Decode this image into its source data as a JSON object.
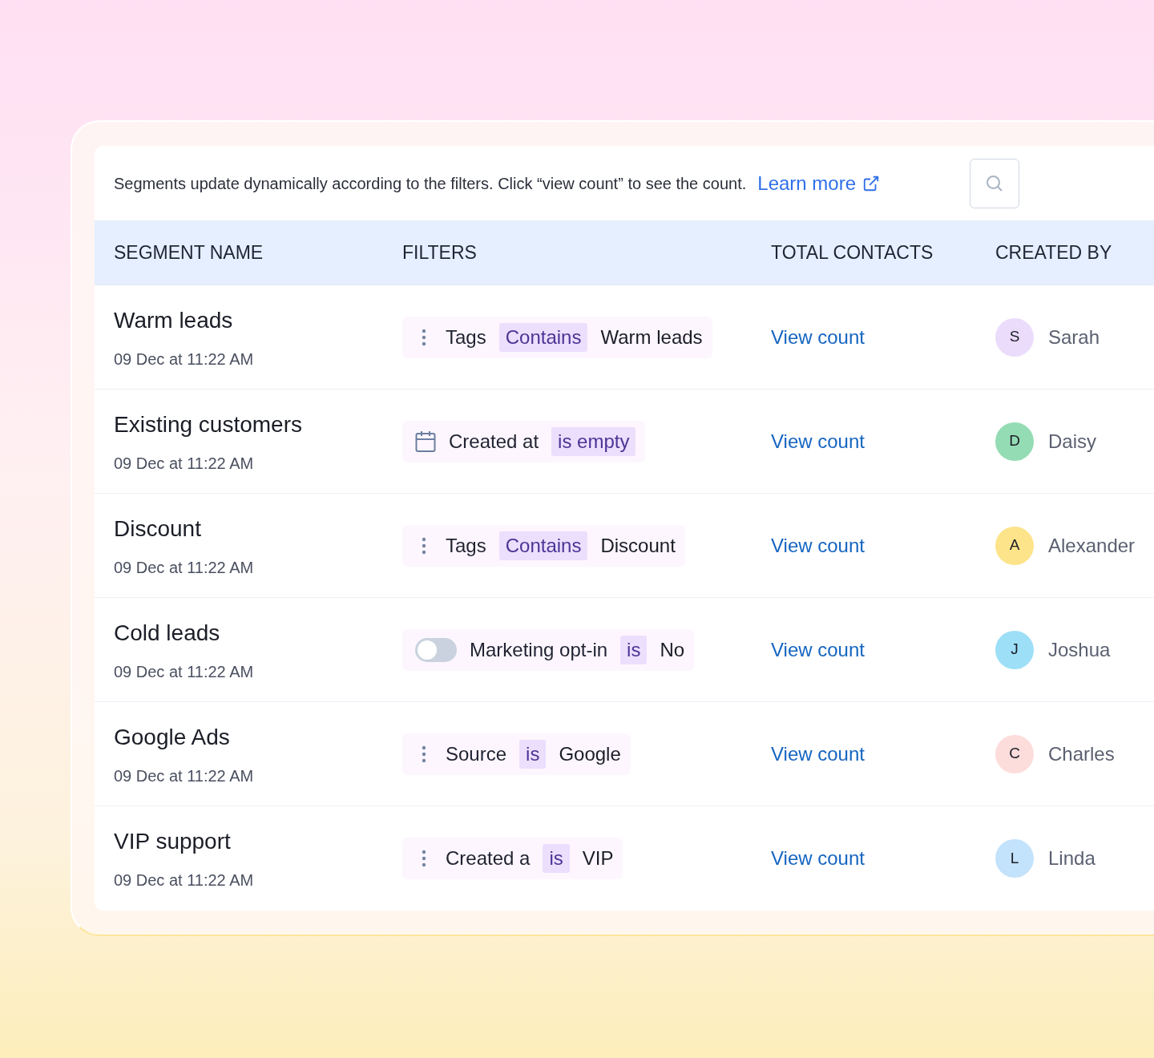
{
  "info_bar": {
    "text": "Segments update dynamically according to the filters. Click “view count” to see the count.",
    "link": "Learn more"
  },
  "table": {
    "columns": [
      "SEGMENT NAME",
      "FILTERS",
      "TOTAL CONTACTS",
      "CREATED BY"
    ],
    "rows": [
      {
        "name": "Warm leads",
        "date": "09 Dec at 11:22 AM",
        "filter": {
          "kind": "menu",
          "field": "Tags",
          "operator": "Contains",
          "value": "Warm leads"
        },
        "count": "View count",
        "creator": {
          "initial": "S",
          "name": "Sarah",
          "color": "#ebdcfb"
        }
      },
      {
        "name": "Existing customers",
        "date": "09 Dec at 11:22 AM",
        "filter": {
          "kind": "date",
          "field": "Created at",
          "operator": "is empty"
        },
        "count": "View count",
        "creator": {
          "initial": "D",
          "name": "Daisy",
          "color": "#94dcb4"
        }
      },
      {
        "name": "Discount",
        "date": "09 Dec at 11:22 AM",
        "filter": {
          "kind": "menu",
          "field": "Tags",
          "operator": "Contains",
          "value": "Discount"
        },
        "count": "View count",
        "creator": {
          "initial": "A",
          "name": "Alexander",
          "color": "#fde48a"
        }
      },
      {
        "name": "Cold leads",
        "date": "09 Dec at 11:22 AM",
        "filter": {
          "kind": "toggle",
          "on": false,
          "field": "Marketing opt-in",
          "operator": "is",
          "value": "No"
        },
        "count": "View count",
        "creator": {
          "initial": "J",
          "name": "Joshua",
          "color": "#9ddff7"
        }
      },
      {
        "name": "Google Ads",
        "date": "09 Dec at 11:22 AM",
        "filter": {
          "kind": "menu",
          "field": "Source",
          "operator": "is",
          "value": "Google"
        },
        "count": "View count",
        "creator": {
          "initial": "C",
          "name": "Charles",
          "color": "#fddcdc"
        }
      },
      {
        "name": "VIP support",
        "date": "09 Dec at 11:22 AM",
        "filter": {
          "kind": "menu",
          "field": "Created a",
          "operator": "is",
          "value": "VIP"
        },
        "count": "View count",
        "creator": {
          "initial": "L",
          "name": "Linda",
          "color": "#c3e2fb"
        }
      }
    ]
  }
}
